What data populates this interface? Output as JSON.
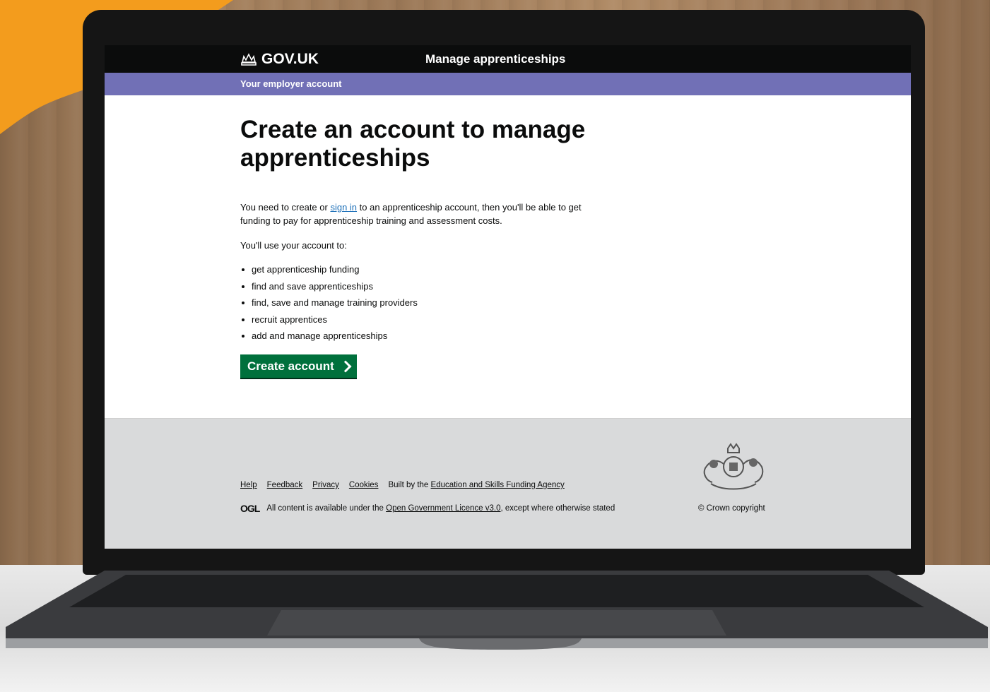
{
  "header": {
    "logo_text": "GOV.UK",
    "service_name": "Manage apprenticeships"
  },
  "sub_nav": {
    "label": "Your employer account"
  },
  "main": {
    "title": "Create an account to manage apprenticeships",
    "intro_before_link": "You need to create or ",
    "intro_link": "sign in",
    "intro_after_link": " to an apprenticeship account, then you'll be able to get funding to pay for apprenticeship training and assessment costs.",
    "use_text": "You'll use your account to:",
    "list_items": [
      "get apprenticeship funding",
      "find and save apprenticeships",
      "find, save and manage training providers",
      "recruit apprentices",
      "add and manage apprenticeships"
    ],
    "button_label": "Create account"
  },
  "footer": {
    "links": [
      "Help",
      "Feedback",
      "Privacy",
      "Cookies"
    ],
    "built_by_prefix": "Built by the ",
    "built_by_link": "Education and Skills Funding Agency",
    "ogl": "OGL",
    "licence_prefix": "All content is available under the ",
    "licence_link": "Open Government Licence v3.0",
    "licence_suffix": ", except where otherwise stated",
    "copyright": "© Crown copyright"
  },
  "colors": {
    "header_bg": "#0b0c0c",
    "sub_nav_bg": "#7170b6",
    "link": "#1d70b8",
    "button_bg": "#00703c",
    "footer_bg": "#d9dadb",
    "accent_orange": "#f39c1d"
  }
}
